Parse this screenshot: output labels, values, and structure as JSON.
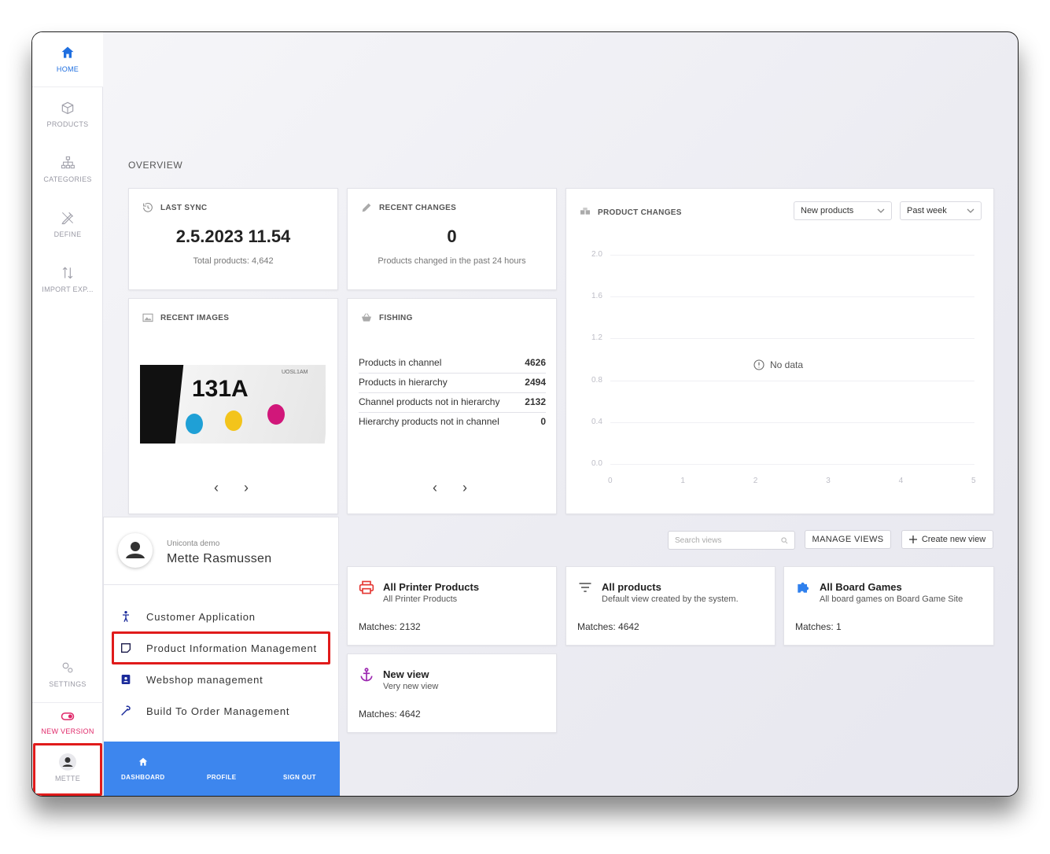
{
  "sidebar": {
    "items": [
      {
        "label": "HOME",
        "icon": "home-icon"
      },
      {
        "label": "PRODUCTS",
        "icon": "box-icon"
      },
      {
        "label": "CATEGORIES",
        "icon": "hierarchy-icon"
      },
      {
        "label": "DEFINE",
        "icon": "pencil-ruler-icon"
      },
      {
        "label": "IMPORT EXP...",
        "icon": "sort-arrows-icon"
      }
    ],
    "settings_label": "SETTINGS",
    "new_version_label": "NEW VERSION",
    "user_label": "METTE"
  },
  "overview": {
    "section_label": "OVERVIEW",
    "last_sync": {
      "title": "LAST SYNC",
      "value": "2.5.2023 11.54",
      "sub": "Total products: 4,642"
    },
    "recent_changes": {
      "title": "RECENT CHANGES",
      "value": "0",
      "sub": "Products changed in the past 24 hours"
    },
    "recent_images": {
      "title": "RECENT IMAGES",
      "image_text": "131A",
      "image_corner": "UOSL1AM"
    },
    "fishing": {
      "title": "FISHING",
      "rows": [
        {
          "label": "Products in channel",
          "value": "4626"
        },
        {
          "label": "Products in hierarchy",
          "value": "2494"
        },
        {
          "label": "Channel products not in hierarchy",
          "value": "2132"
        },
        {
          "label": "Hierarchy products not in channel",
          "value": "0"
        }
      ]
    },
    "product_changes": {
      "title": "PRODUCT CHANGES",
      "filter_type": "New products",
      "filter_period": "Past week",
      "no_data": "No data"
    }
  },
  "chart_data": {
    "type": "line",
    "title": "PRODUCT CHANGES",
    "x": [
      0,
      1,
      2,
      3,
      4,
      5
    ],
    "x_tick_labels": [
      "0",
      "1",
      "2",
      "3",
      "4",
      "5"
    ],
    "y_tick_labels": [
      "2.0",
      "1.6",
      "1.2",
      "0.8",
      "0.4",
      "0.0"
    ],
    "ylim": [
      0,
      2.0
    ],
    "series": [],
    "annotation": "No data",
    "grid": true
  },
  "views": {
    "search_placeholder": "Search views",
    "manage_label": "MANAGE VIEWS",
    "create_label": "Create new view",
    "cards": [
      {
        "title": "All Printer Products",
        "sub": "All Printer Products",
        "matches": "Matches: 2132",
        "icon": "printer-icon",
        "color": "#e53935"
      },
      {
        "title": "All products",
        "sub": "Default view created by the system.",
        "matches": "Matches: 4642",
        "icon": "filter-icon",
        "color": "#666666"
      },
      {
        "title": "All Board Games",
        "sub": "All board games on Board Game Site",
        "matches": "Matches: 1",
        "icon": "puzzle-icon",
        "color": "#2f80ed"
      },
      {
        "title": "New view",
        "sub": "Very new view",
        "matches": "Matches: 4642",
        "icon": "anchor-icon",
        "color": "#9c27b0"
      }
    ]
  },
  "profile": {
    "company": "Uniconta demo",
    "name": "Mette Rasmussen",
    "apps": [
      {
        "label": "Customer Application",
        "icon": "person-icon"
      },
      {
        "label": "Product Information Management",
        "icon": "note-icon"
      },
      {
        "label": "Webshop management",
        "icon": "badge-icon"
      },
      {
        "label": "Build To Order Management",
        "icon": "wrench-icon"
      }
    ],
    "footer": {
      "dashboard": "DASHBOARD",
      "profile": "PROFILE",
      "signout": "SIGN OUT"
    }
  },
  "colors": {
    "accent": "#1f6fe0",
    "footer_blue": "#3d86ee",
    "highlight": "#e01b1b",
    "new_version": "#e02869"
  }
}
